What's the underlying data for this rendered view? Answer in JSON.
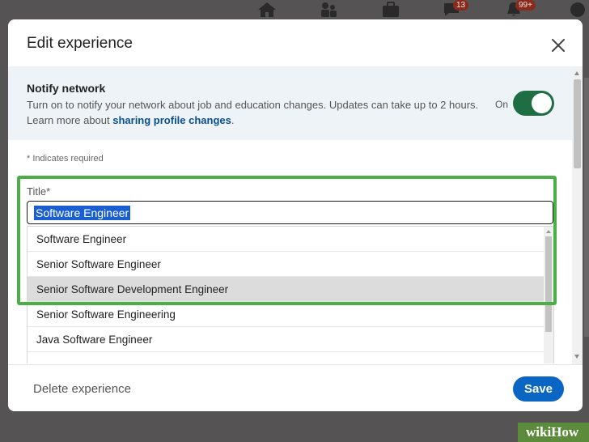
{
  "background_nav": {
    "messaging_badge": "13",
    "notifications_badge": "99+"
  },
  "dialog": {
    "title": "Edit experience",
    "notify": {
      "heading": "Notify network",
      "description": "Turn on to notify your network about job and education changes. Updates can take up to 2 hours. Learn more about ",
      "link_text": "sharing profile changes",
      "description_end": ".",
      "toggle_label": "On",
      "toggle_on": true
    },
    "required_note": "* Indicates required",
    "title_field": {
      "label": "Title*",
      "value": "Software Engineer"
    },
    "suggestions": [
      "Software Engineer",
      "Senior Software Engineer",
      "Senior Software Development Engineer",
      "Senior Software Engineering",
      "Java Software Engineer"
    ],
    "highlighted_suggestion_index": 2,
    "footer": {
      "delete_label": "Delete experience",
      "save_label": "Save"
    }
  },
  "watermark": "wikiHow",
  "colors": {
    "primary": "#0a66c2",
    "toggle_on": "#1f6e43",
    "highlight_frame": "#4cae47",
    "overlay": "#555353"
  }
}
